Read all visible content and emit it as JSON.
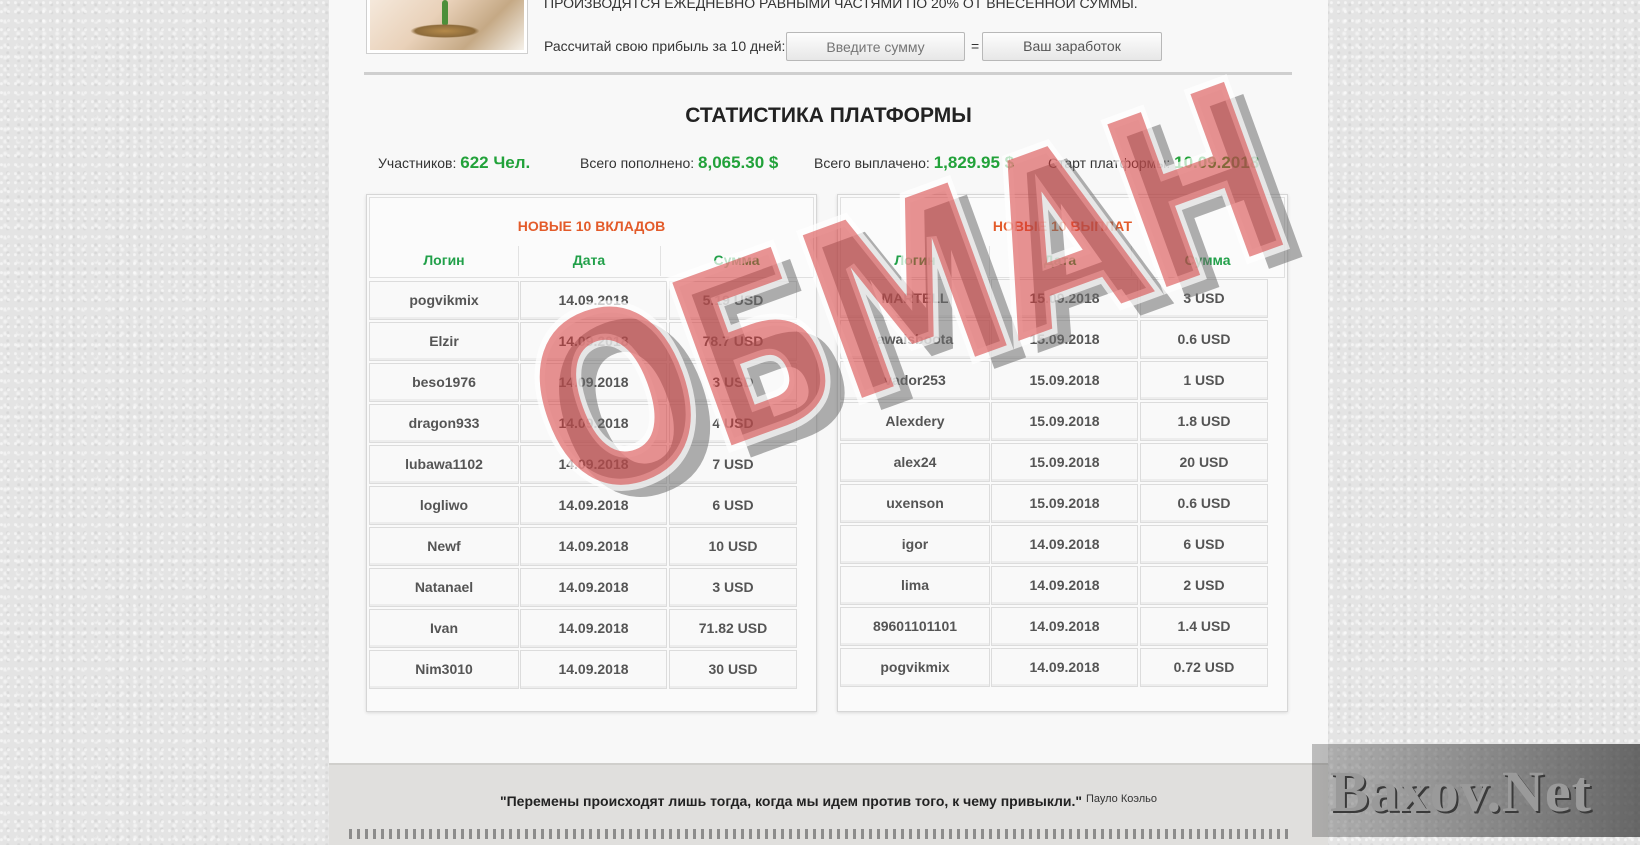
{
  "hero": {
    "text": "ПРОИЗВОДЯТСЯ ЕЖЕДНЕВНО РАВНЫМИ ЧАСТЯМИ ПО 20% ОТ ВНЕСЕННОЙ СУММЫ."
  },
  "calculator": {
    "label": "Рассчитай свою прибыль за 10 дней:",
    "input_placeholder": "Введите сумму",
    "equals": "=",
    "result_label": "Ваш заработок"
  },
  "stats": {
    "title": "СТАТИСТИКА ПЛАТФОРМЫ",
    "participants_label": "Участников:",
    "participants_value": "622 Чел.",
    "deposited_label": "Всего пополнено:",
    "deposited_value": "8,065.30 $",
    "paid_label": "Всего выплачено:",
    "paid_value": "1,829.95 $",
    "start_label": "Старт платформы:",
    "start_value": "10.09.2018"
  },
  "deposits": {
    "title": "НОВЫЕ 10 ВКЛАДОВ",
    "headers": [
      "Логин",
      "Дата",
      "Сумма"
    ],
    "rows": [
      [
        "pogvikmix",
        "14.09.2018",
        "5.19 USD"
      ],
      [
        "Elzir",
        "14.09.2018",
        "78.7 USD"
      ],
      [
        "beso1976",
        "14.09.2018",
        "3 USD"
      ],
      [
        "dragon933",
        "14.09.2018",
        "4 USD"
      ],
      [
        "lubawa1102",
        "14.09.2018",
        "7 USD"
      ],
      [
        "logliwo",
        "14.09.2018",
        "6 USD"
      ],
      [
        "Newf",
        "14.09.2018",
        "10 USD"
      ],
      [
        "Natanael",
        "14.09.2018",
        "3 USD"
      ],
      [
        "Ivan",
        "14.09.2018",
        "71.82 USD"
      ],
      [
        "Nim3010",
        "14.09.2018",
        "30 USD"
      ]
    ]
  },
  "payouts": {
    "title": "НОВЫЕ 10 ВЫПЛАТ",
    "headers": [
      "Логин",
      "Дата",
      "Сумма"
    ],
    "rows": [
      [
        "MARTELL",
        "15.09.2018",
        "3 USD"
      ],
      [
        "awaisboota",
        "15.09.2018",
        "0.6 USD"
      ],
      [
        "vador253",
        "15.09.2018",
        "1 USD"
      ],
      [
        "Alexdery",
        "15.09.2018",
        "1.8 USD"
      ],
      [
        "alex24",
        "15.09.2018",
        "20 USD"
      ],
      [
        "uxenson",
        "15.09.2018",
        "0.6 USD"
      ],
      [
        "igor",
        "14.09.2018",
        "6 USD"
      ],
      [
        "lima",
        "14.09.2018",
        "2 USD"
      ],
      [
        "89601101101",
        "14.09.2018",
        "1.4 USD"
      ],
      [
        "pogvikmix",
        "14.09.2018",
        "0.72 USD"
      ]
    ]
  },
  "stamp": {
    "text": "ОБМАН"
  },
  "footer": {
    "quote": "\"Перемены происходят лишь тогда, когда мы идем против того, к чему привыкли.\"",
    "author": "Пауло Коэльо"
  },
  "watermark": {
    "text": "Baxov.Net"
  },
  "colors": {
    "accent_green": "#22a23a",
    "header_orange": "#e35b2a",
    "stamp_red": "#d63a3a"
  }
}
